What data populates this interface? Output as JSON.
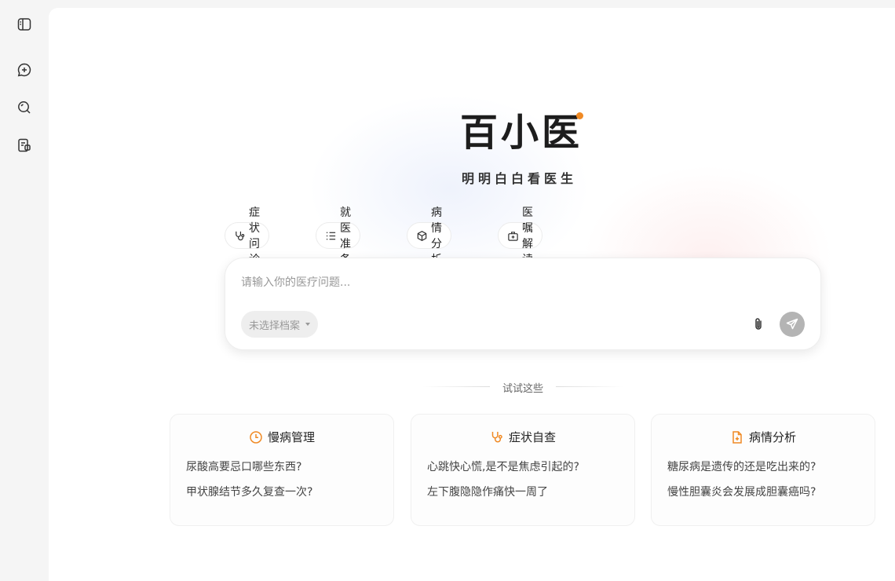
{
  "sidebar": {
    "icons": [
      {
        "name": "sidebar-toggle-icon"
      },
      {
        "name": "new-chat-icon"
      },
      {
        "name": "search-icon"
      },
      {
        "name": "records-icon"
      }
    ]
  },
  "brand": {
    "logo_text": "百小医",
    "slogan": "明明白白看医生",
    "accent_color": "#f08a24"
  },
  "chips": [
    {
      "label": "症状问诊",
      "icon": "stethoscope-icon"
    },
    {
      "label": "就医准备",
      "icon": "checklist-icon"
    },
    {
      "label": "病情分析",
      "icon": "cube-icon"
    },
    {
      "label": "医嘱解读",
      "icon": "medkit-icon"
    }
  ],
  "input": {
    "placeholder": "请输入你的医疗问题...",
    "value": "",
    "profile_select": "未选择档案"
  },
  "suggestions": {
    "divider_label": "试试这些",
    "cards": [
      {
        "title": "慢病管理",
        "icon": "clock-icon",
        "questions": [
          "尿酸高要忌口哪些东西?",
          "甲状腺结节多久复查一次?"
        ]
      },
      {
        "title": "症状自查",
        "icon": "stethoscope-icon",
        "questions": [
          "心跳快心慌,是不是焦虑引起的?",
          "左下腹隐隐作痛快一周了"
        ]
      },
      {
        "title": "病情分析",
        "icon": "document-plus-icon",
        "questions": [
          "糖尿病是遗传的还是吃出来的?",
          "慢性胆囊炎会发展成胆囊癌吗?"
        ]
      }
    ]
  }
}
